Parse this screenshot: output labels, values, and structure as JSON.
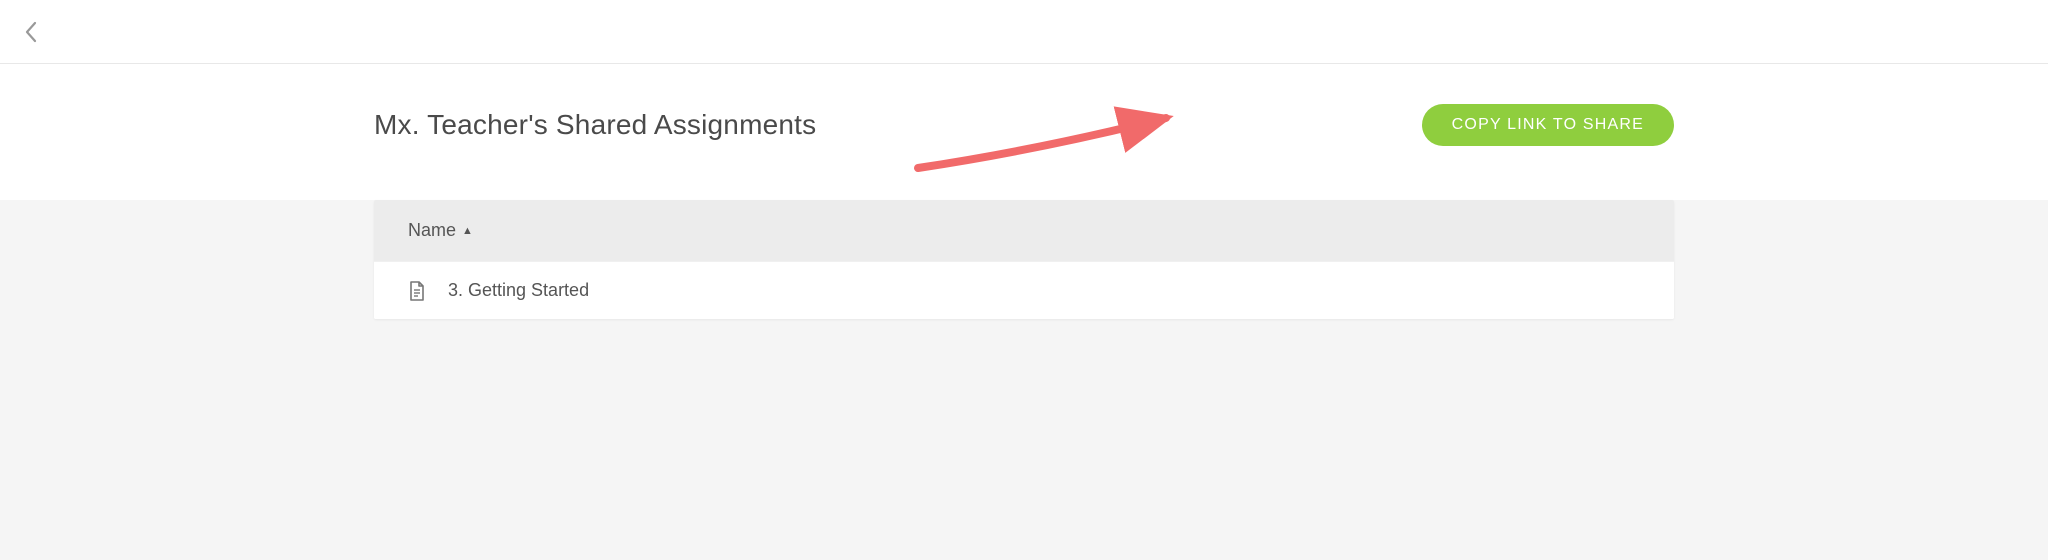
{
  "header": {
    "title": "Mx. Teacher's Shared Assignments",
    "copy_button_label": "COPY LINK TO SHARE"
  },
  "table": {
    "column_name_label": "Name",
    "rows": [
      {
        "label": "3. Getting Started"
      }
    ]
  },
  "colors": {
    "accent_green": "#8fce3e",
    "annotation_red": "#f16a6a"
  }
}
